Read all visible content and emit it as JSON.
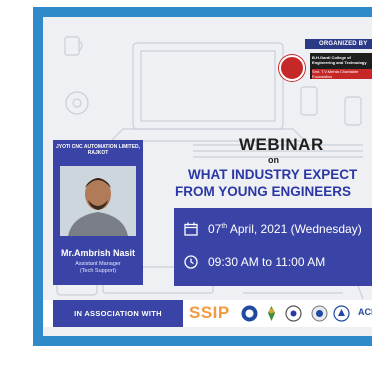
{
  "organizer": {
    "ribbon_text": "ORGANIZED BY",
    "college_line1": "B.H.Gardi College of",
    "college_line2": "Engineering and Technology",
    "college_line3": "Smt. T.V.Mehta Charitable Foundation"
  },
  "speaker": {
    "company": "JYOTI CNC AUTOMATION LIMITED, RAJKOT",
    "name": "Mr.Ambrish Nasit",
    "role_line1": "Assistant Manager",
    "role_line2": "(Tech Support)"
  },
  "event": {
    "heading": "WEBINAR",
    "connector": "on",
    "title_line1": "WHAT INDUSTRY EXPECT",
    "title_line2": "FROM YOUNG ENGINEERS",
    "date_day": "07",
    "date_suffix": "th",
    "date_rest": " April, 2021 (Wednesday)",
    "time": "09:30 AM to 11:00 AM"
  },
  "association": {
    "label": "IN ASSOCIATION WITH",
    "ssip_text": "SSIP",
    "acm_text": "ACM"
  },
  "colors": {
    "frame": "#2e8ac8",
    "primary_blue": "#3a43a6",
    "title_blue": "#2b37a4",
    "ssip_orange": "#f19a3e"
  },
  "icons": [
    "calendar-icon",
    "clock-icon",
    "college-logo-icon",
    "partner-logos"
  ]
}
